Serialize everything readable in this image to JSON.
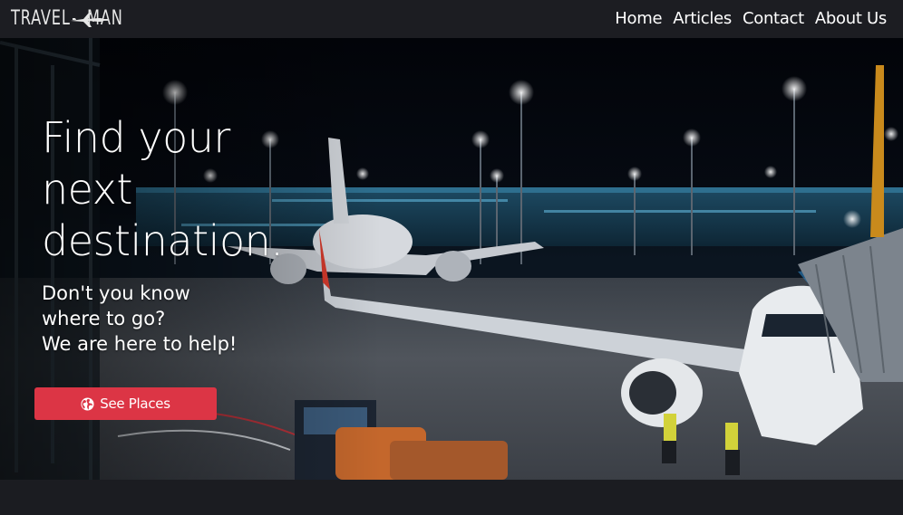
{
  "brand": {
    "left": "TRAVEL",
    "right": "MAN",
    "logo_icon": "airplane-icon"
  },
  "nav": {
    "items": [
      {
        "label": "Home"
      },
      {
        "label": "Articles"
      },
      {
        "label": "Contact"
      },
      {
        "label": "About Us"
      }
    ]
  },
  "hero": {
    "title_lines": [
      "Find your",
      "next",
      "destination."
    ],
    "subtitle_lines": [
      "Don't you know",
      "where to go?",
      "We are here to help!"
    ],
    "cta": {
      "label": "See Places",
      "icon": "globe-icon"
    }
  },
  "colors": {
    "navbar_bg": "#1c1d22",
    "page_bg": "#1b1c21",
    "cta_bg": "#dc3545",
    "text": "#ffffff"
  }
}
